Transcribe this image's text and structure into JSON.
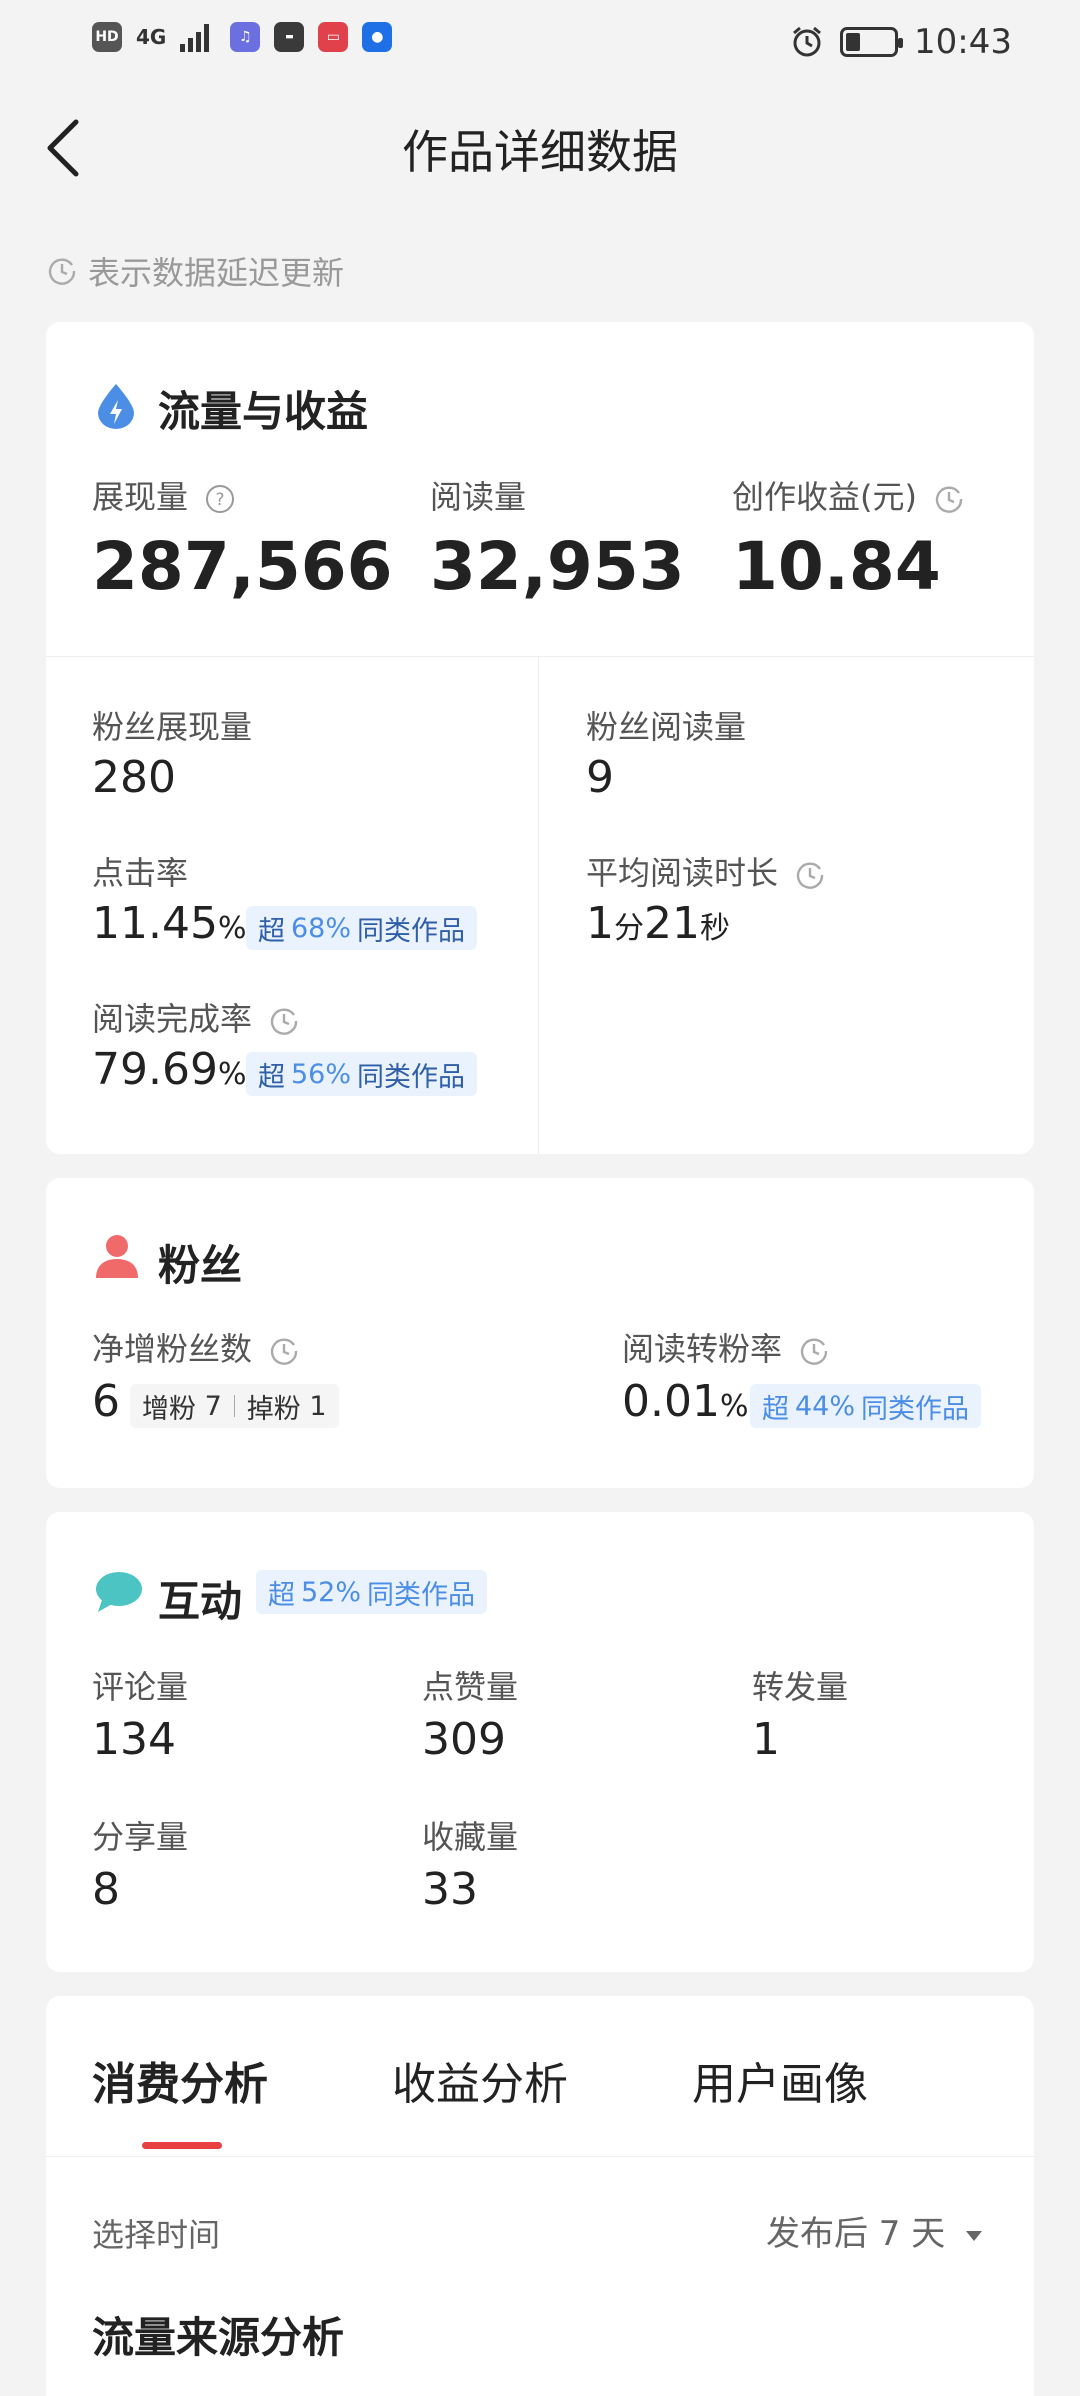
{
  "status_bar": {
    "time": "10:43",
    "hd": "HD",
    "network": "4G",
    "icons": [
      "music-icon",
      "huawei-icon",
      "reader-icon",
      "bulb-icon"
    ],
    "alarm_icon": "alarm-icon",
    "battery_icon": "battery-icon"
  },
  "header": {
    "title": "作品详细数据",
    "back_icon": "back-chevron-icon"
  },
  "delay_note": "表示数据延迟更新",
  "traffic": {
    "title": "流量与收益",
    "icon": "lightning-drop-icon",
    "icon_color": "#4c8ee6",
    "impressions_label": "展现量",
    "impressions_value": "287,566",
    "reads_label": "阅读量",
    "reads_value": "32,953",
    "earnings_label": "创作收益(元)",
    "earnings_value": "10.84",
    "fan_impressions_label": "粉丝展现量",
    "fan_impressions_value": "280",
    "fan_reads_label": "粉丝阅读量",
    "fan_reads_value": "9",
    "ctr_label": "点击率",
    "ctr_value": "11.45",
    "ctr_unit": "%",
    "ctr_badge": {
      "prefix": "超",
      "pct": "68%",
      "suffix": "同类作品"
    },
    "avg_time_label": "平均阅读时长",
    "avg_time_min": "1",
    "avg_time_min_unit": "分",
    "avg_time_sec": "21",
    "avg_time_sec_unit": "秒",
    "completion_label": "阅读完成率",
    "completion_value": "79.69",
    "completion_unit": "%",
    "completion_badge": {
      "prefix": "超",
      "pct": "56%",
      "suffix": "同类作品"
    }
  },
  "fans": {
    "title": "粉丝",
    "icon": "person-icon",
    "icon_color": "#f06a6a",
    "net_label": "净增粉丝数",
    "net_value": "6",
    "gain_label": "增粉",
    "gain_value": "7",
    "lose_label": "掉粉",
    "lose_value": "1",
    "conv_label": "阅读转粉率",
    "conv_value": "0.01",
    "conv_unit": "%",
    "conv_badge": {
      "prefix": "超",
      "pct": "44%",
      "suffix": "同类作品"
    }
  },
  "interaction": {
    "title": "互动",
    "icon": "chat-bubble-icon",
    "icon_color": "#4cc4c4",
    "badge": {
      "prefix": "超",
      "pct": "52%",
      "suffix": "同类作品"
    },
    "comments_label": "评论量",
    "comments_value": "134",
    "likes_label": "点赞量",
    "likes_value": "309",
    "forwards_label": "转发量",
    "forwards_value": "1",
    "shares_label": "分享量",
    "shares_value": "8",
    "favorites_label": "收藏量",
    "favorites_value": "33"
  },
  "tabs": [
    {
      "label": "消费分析",
      "active": true
    },
    {
      "label": "收益分析",
      "active": false
    },
    {
      "label": "用户画像",
      "active": false
    }
  ],
  "time_select": {
    "label": "选择时间",
    "value": "发布后 7 天"
  },
  "source_title": "流量来源分析"
}
